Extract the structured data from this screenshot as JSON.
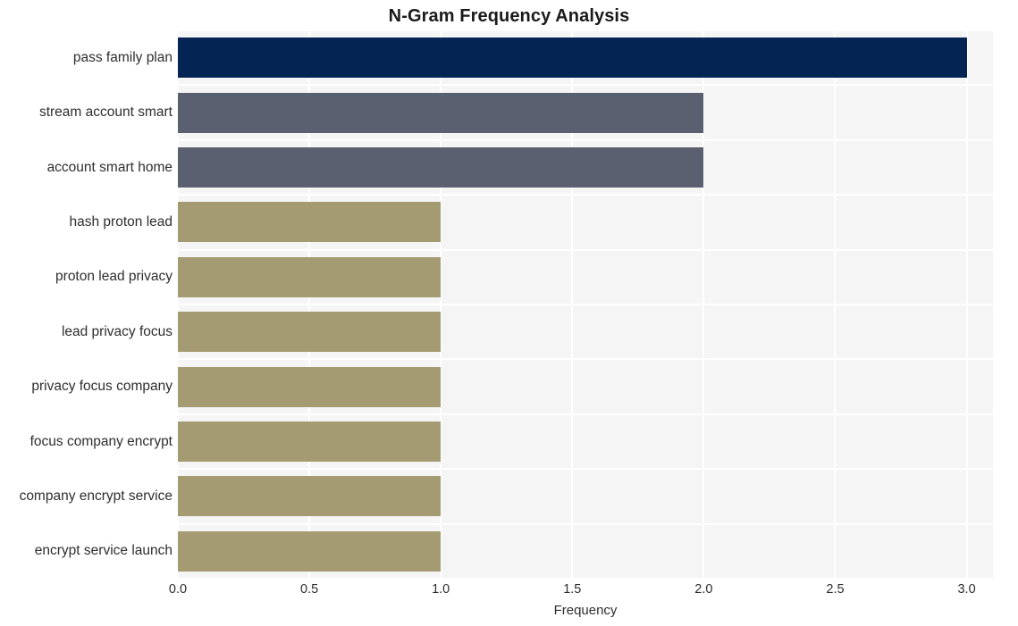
{
  "chart_data": {
    "type": "bar",
    "orientation": "horizontal",
    "title": "N-Gram Frequency Analysis",
    "xlabel": "Frequency",
    "ylabel": "",
    "categories": [
      "pass family plan",
      "stream account smart",
      "account smart home",
      "hash proton lead",
      "proton lead privacy",
      "lead privacy focus",
      "privacy focus company",
      "focus company encrypt",
      "company encrypt service",
      "encrypt service launch"
    ],
    "values": [
      3,
      2,
      2,
      1,
      1,
      1,
      1,
      1,
      1,
      1
    ],
    "bar_colors": [
      "#042553",
      "#5b6070",
      "#5b6070",
      "#a49b73",
      "#a49b73",
      "#a49b73",
      "#a49b73",
      "#a49b73",
      "#a49b73",
      "#a49b73"
    ],
    "xlim": [
      0,
      3.1
    ],
    "xticks": [
      0.0,
      0.5,
      1.0,
      1.5,
      2.0,
      2.5,
      3.0
    ],
    "xtick_labels": [
      "0.0",
      "0.5",
      "1.0",
      "1.5",
      "2.0",
      "2.5",
      "3.0"
    ],
    "grid": true,
    "grid_color": "#ffffff",
    "plot_background": "#f5f5f6",
    "figure_background": "#ffffff",
    "legend": null,
    "legend_position": "none"
  }
}
